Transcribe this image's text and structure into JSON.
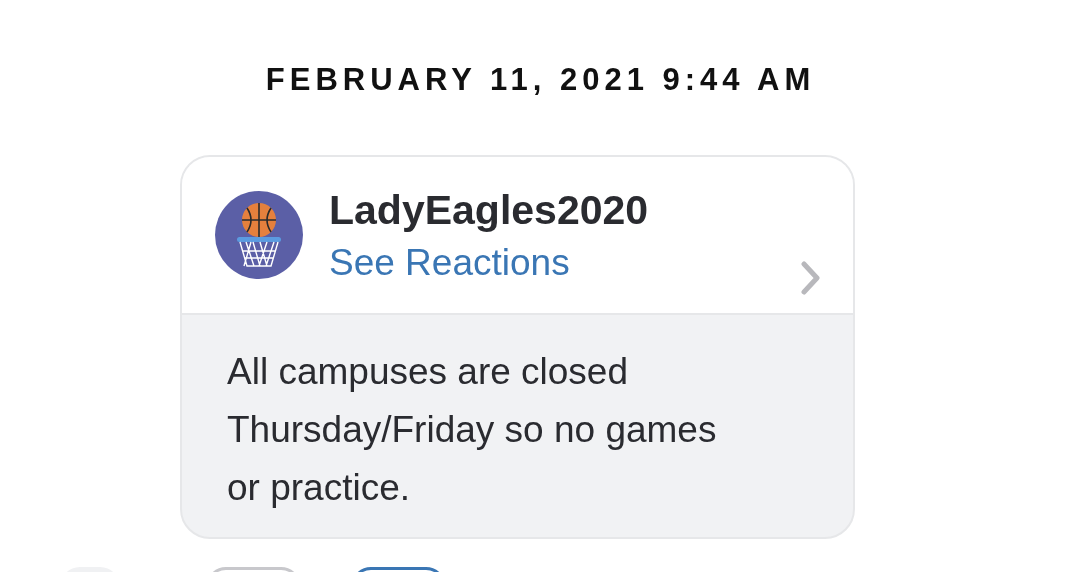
{
  "timestamp": "FEBRUARY 11, 2021 9:44 AM",
  "message": {
    "sender": "LadyEagles2020",
    "reactions_link": "See Reactions",
    "text": "All campuses are closed Thursday/Friday so no games or practice."
  },
  "reaction_buttons": [
    {
      "kind": "plain"
    },
    {
      "kind": "outlined"
    },
    {
      "kind": "selected"
    }
  ]
}
